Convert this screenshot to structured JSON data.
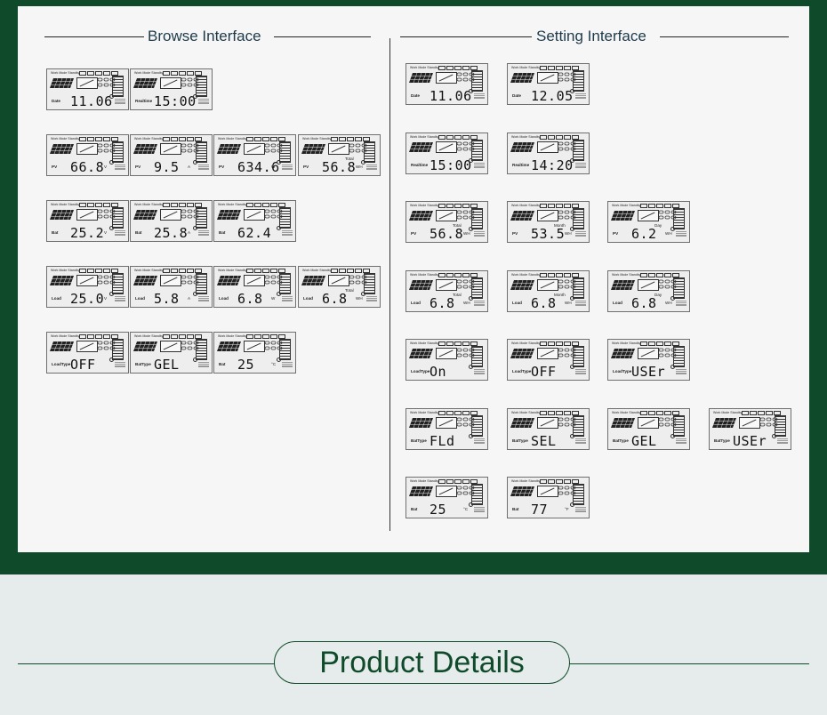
{
  "browse": {
    "title": "Browse Interface",
    "screens": [
      {
        "label": "Date",
        "value": "11.06",
        "unit": ""
      },
      {
        "label": "Realtime",
        "value": "15:00",
        "unit": ""
      },
      {
        "label": "PV",
        "value": "66.8",
        "unit": "V"
      },
      {
        "label": "PV",
        "value": "9.5",
        "unit": "A"
      },
      {
        "label": "PV",
        "value": "634.6",
        "unit": "W"
      },
      {
        "label": "PV",
        "value": "56.8",
        "unit": "WH",
        "sub": "Total"
      },
      {
        "label": "Bat",
        "value": "25.2",
        "unit": "V"
      },
      {
        "label": "Bat",
        "value": "25.8",
        "unit": "A"
      },
      {
        "label": "Bat",
        "value": "62.4",
        "unit": ""
      },
      {
        "label": "Load",
        "value": "25.0",
        "unit": "V"
      },
      {
        "label": "Load",
        "value": "5.8",
        "unit": "A"
      },
      {
        "label": "Load",
        "value": "6.8",
        "unit": "W"
      },
      {
        "label": "Load",
        "value": "6.8",
        "unit": "WH",
        "sub": "Total"
      },
      {
        "label": "LoadType",
        "value": "OFF",
        "unit": ""
      },
      {
        "label": "BatType",
        "value": "GEL",
        "unit": ""
      },
      {
        "label": "Bat",
        "value": "25",
        "unit": "°C"
      }
    ]
  },
  "setting": {
    "title": "Setting Interface",
    "screens": [
      {
        "label": "Date",
        "value": "11.06",
        "unit": ""
      },
      {
        "label": "Date",
        "value": "12.05",
        "unit": ""
      },
      {
        "label": "Realtime",
        "value": "15:00",
        "unit": ""
      },
      {
        "label": "Realtime",
        "value": "14:20",
        "unit": ""
      },
      {
        "label": "PV",
        "value": "56.8",
        "unit": "WH",
        "sub": "Total"
      },
      {
        "label": "PV",
        "value": "53.5",
        "unit": "WH",
        "sub": "Month"
      },
      {
        "label": "PV",
        "value": "6.2",
        "unit": "WH",
        "sub": "Day"
      },
      {
        "label": "Load",
        "value": "6.8",
        "unit": "WH",
        "sub": "Total"
      },
      {
        "label": "Load",
        "value": "6.8",
        "unit": "WH",
        "sub": "Month"
      },
      {
        "label": "Load",
        "value": "6.8",
        "unit": "WH",
        "sub": "Day"
      },
      {
        "label": "LoadType",
        "value": "On",
        "unit": ""
      },
      {
        "label": "LoadType",
        "value": "OFF",
        "unit": ""
      },
      {
        "label": "LoadType",
        "value": "USEr",
        "unit": ""
      },
      {
        "label": "BatType",
        "value": "FLd",
        "unit": ""
      },
      {
        "label": "BatType",
        "value": "SEL",
        "unit": ""
      },
      {
        "label": "BatType",
        "value": "GEL",
        "unit": ""
      },
      {
        "label": "BatType",
        "value": "USEr",
        "unit": ""
      },
      {
        "label": "Bat",
        "value": "25",
        "unit": "°C"
      },
      {
        "label": "Bat",
        "value": "77",
        "unit": "°F"
      }
    ]
  },
  "lcd_header": "Work Mode Standby",
  "footer": {
    "title": "Product Details"
  },
  "colors": {
    "band": "#0f4b2a",
    "panel": "#f6f6f6",
    "bottom": "#e6ecec"
  }
}
